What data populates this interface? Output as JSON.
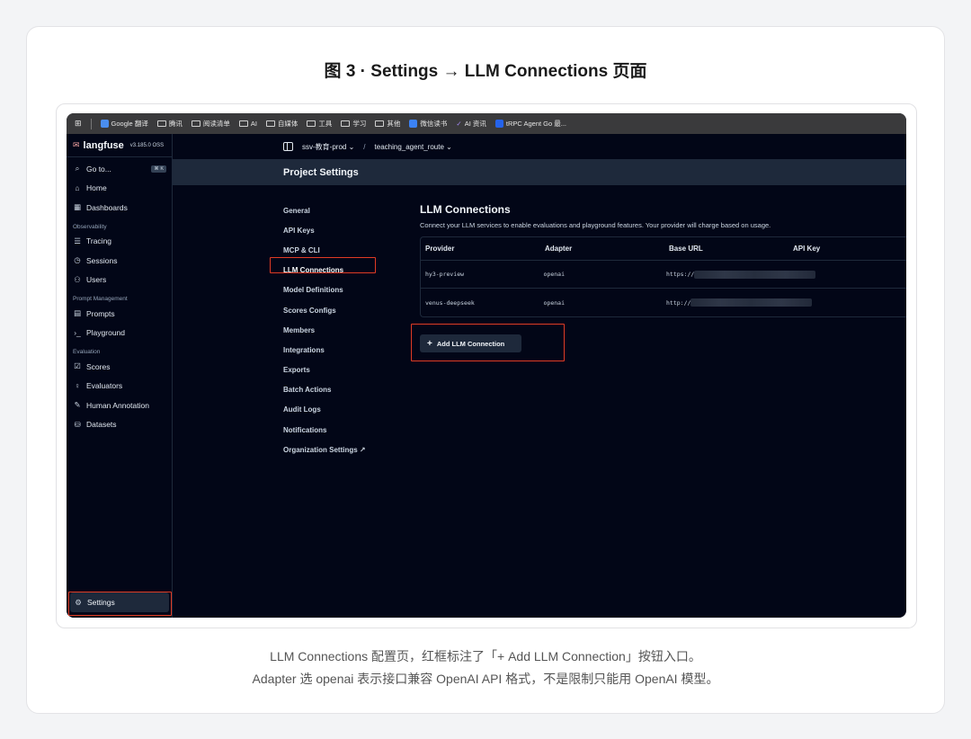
{
  "figure": {
    "title": "图 3 · Settings → LLM Connections 页面",
    "caption_line1": "LLM Connections 配置页，红框标注了「+ Add LLM Connection」按钮入口。",
    "caption_line2": "Adapter 选 openai 表示接口兼容 OpenAI API 格式，不是限制只能用 OpenAI 模型。"
  },
  "bookmarks": [
    {
      "label": "Google 翻译",
      "icon": "translate-icon"
    },
    {
      "label": "腾讯",
      "icon": "folder-icon"
    },
    {
      "label": "阅读清单",
      "icon": "folder-icon"
    },
    {
      "label": "AI",
      "icon": "folder-icon"
    },
    {
      "label": "自媒体",
      "icon": "folder-icon"
    },
    {
      "label": "工具",
      "icon": "folder-icon"
    },
    {
      "label": "学习",
      "icon": "folder-icon"
    },
    {
      "label": "其他",
      "icon": "folder-icon"
    },
    {
      "label": "微信读书",
      "icon": "weread-icon"
    },
    {
      "label": "AI 资讯",
      "icon": "ai-news-icon"
    },
    {
      "label": "tRPC Agent Go 最...",
      "icon": "trpc-icon"
    }
  ],
  "app": {
    "name": "langfuse",
    "version": "v3.185.0 OSS",
    "goto_label": "Go to...",
    "goto_shortcut": "⌘ K"
  },
  "sidebar": {
    "top_items": [
      {
        "label": "Home",
        "icon": "home-icon"
      },
      {
        "label": "Dashboards",
        "icon": "dashboard-icon"
      }
    ],
    "groups": [
      {
        "label": "Observability",
        "items": [
          {
            "label": "Tracing",
            "icon": "tracing-icon"
          },
          {
            "label": "Sessions",
            "icon": "clock-icon"
          },
          {
            "label": "Users",
            "icon": "users-icon"
          }
        ]
      },
      {
        "label": "Prompt Management",
        "items": [
          {
            "label": "Prompts",
            "icon": "file-icon"
          },
          {
            "label": "Playground",
            "icon": "terminal-icon"
          }
        ]
      },
      {
        "label": "Evaluation",
        "items": [
          {
            "label": "Scores",
            "icon": "score-icon"
          },
          {
            "label": "Evaluators",
            "icon": "bulb-icon"
          },
          {
            "label": "Human Annotation",
            "icon": "annotation-icon"
          },
          {
            "label": "Datasets",
            "icon": "database-icon"
          }
        ]
      }
    ],
    "settings_label": "Settings"
  },
  "header": {
    "project": "ssv-教育-prod",
    "route": "teaching_agent_route",
    "page_title": "Project Settings"
  },
  "settings_nav": [
    "General",
    "API Keys",
    "MCP & CLI",
    "LLM Connections",
    "Model Definitions",
    "Scores Configs",
    "Members",
    "Integrations",
    "Exports",
    "Batch Actions",
    "Audit Logs",
    "Notifications",
    "Organization Settings ↗"
  ],
  "settings_nav_active": "LLM Connections",
  "llm_connections": {
    "title": "LLM Connections",
    "description": "Connect your LLM services to enable evaluations and playground features. Your provider will charge based on usage.",
    "columns": [
      "Provider",
      "Adapter",
      "Base URL",
      "API Key"
    ],
    "rows": [
      {
        "provider": "hy3-preview",
        "adapter": "openai",
        "base_url": "https://"
      },
      {
        "provider": "venus-deepseek",
        "adapter": "openai",
        "base_url": "http://"
      }
    ],
    "add_button": "Add LLM Connection"
  },
  "colors": {
    "highlight": "#e03b24",
    "app_bg": "#020617",
    "panel": "#1e293b"
  }
}
